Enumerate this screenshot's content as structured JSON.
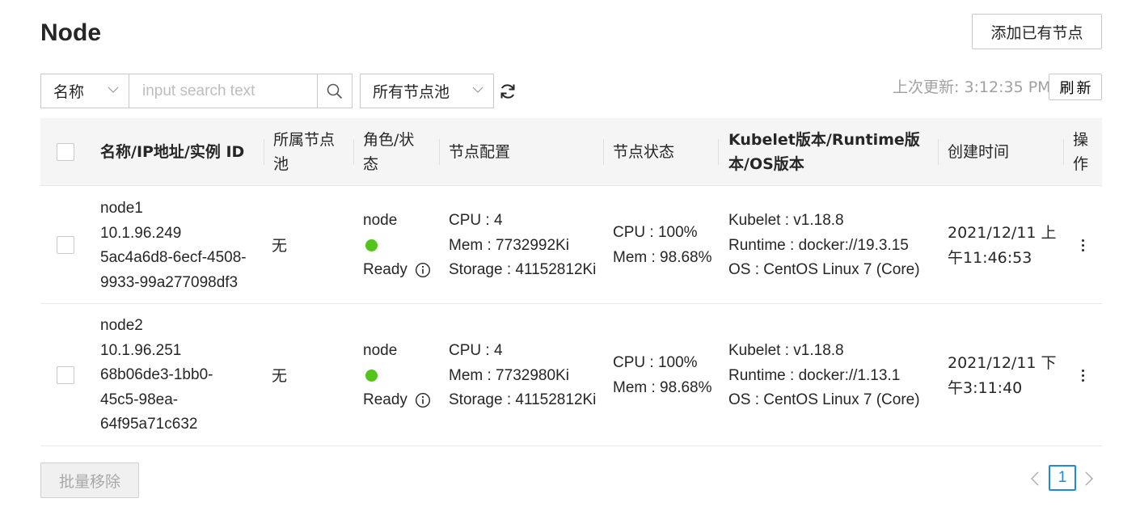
{
  "header": {
    "title": "Node",
    "add_node_label": "添加已有节点"
  },
  "toolbar": {
    "field_select_value": "名称",
    "search_placeholder": "input search text",
    "pool_select_value": "所有节点池",
    "last_updated": "上次更新: 3:12:35 PM",
    "refresh_label": "刷新"
  },
  "table": {
    "headers": {
      "name": "名称/IP地址/实例 ID",
      "pool_line1": "所属节点",
      "pool_line2": "池",
      "role_line1": "角色/状",
      "role_line2": "态",
      "config": "节点配置",
      "status": "节点状态",
      "version_line1": "Kubelet版本/Runtime版",
      "version_line2": "本/OS版本",
      "created": "创建时间",
      "ops_line1": "操",
      "ops_line2": "作"
    },
    "rows": [
      {
        "name": "node1",
        "ip": "10.1.96.249",
        "id_lines": [
          "5ac4a6d8-6ecf-4508-",
          "9933-99a277098df3"
        ],
        "pool": "无",
        "role": "node",
        "state": "Ready",
        "state_color": "#52c41a",
        "cpu": "CPU : 4",
        "mem": "Mem : 7732992Ki",
        "storage": "Storage : 41152812Ki",
        "cpu_usage": "CPU : 100%",
        "mem_usage": "Mem : 98.68%",
        "kubelet": "Kubelet : v1.18.8",
        "runtime": "Runtime : docker://19.3.15",
        "os": "OS : CentOS Linux 7 (Core)",
        "created_line1": "2021/12/11 上",
        "created_line2": "午11:46:53"
      },
      {
        "name": "node2",
        "ip": "10.1.96.251",
        "id_lines": [
          "68b06de3-1bb0-",
          "45c5-98ea-",
          "64f95a71c632"
        ],
        "pool": "无",
        "role": "node",
        "state": "Ready",
        "state_color": "#52c41a",
        "cpu": "CPU : 4",
        "mem": "Mem : 7732980Ki",
        "storage": "Storage : 41152812Ki",
        "cpu_usage": "CPU : 100%",
        "mem_usage": "Mem : 98.68%",
        "kubelet": "Kubelet : v1.18.8",
        "runtime": "Runtime : docker://1.13.1",
        "os": "OS : CentOS Linux 7 (Core)",
        "created_line1": "2021/12/11 下",
        "created_line2": "午3:11:40"
      }
    ]
  },
  "footer": {
    "batch_remove_label": "批量移除",
    "current_page": "1"
  },
  "colors": {
    "accent": "#1e88e5",
    "ready": "#52c41a"
  }
}
